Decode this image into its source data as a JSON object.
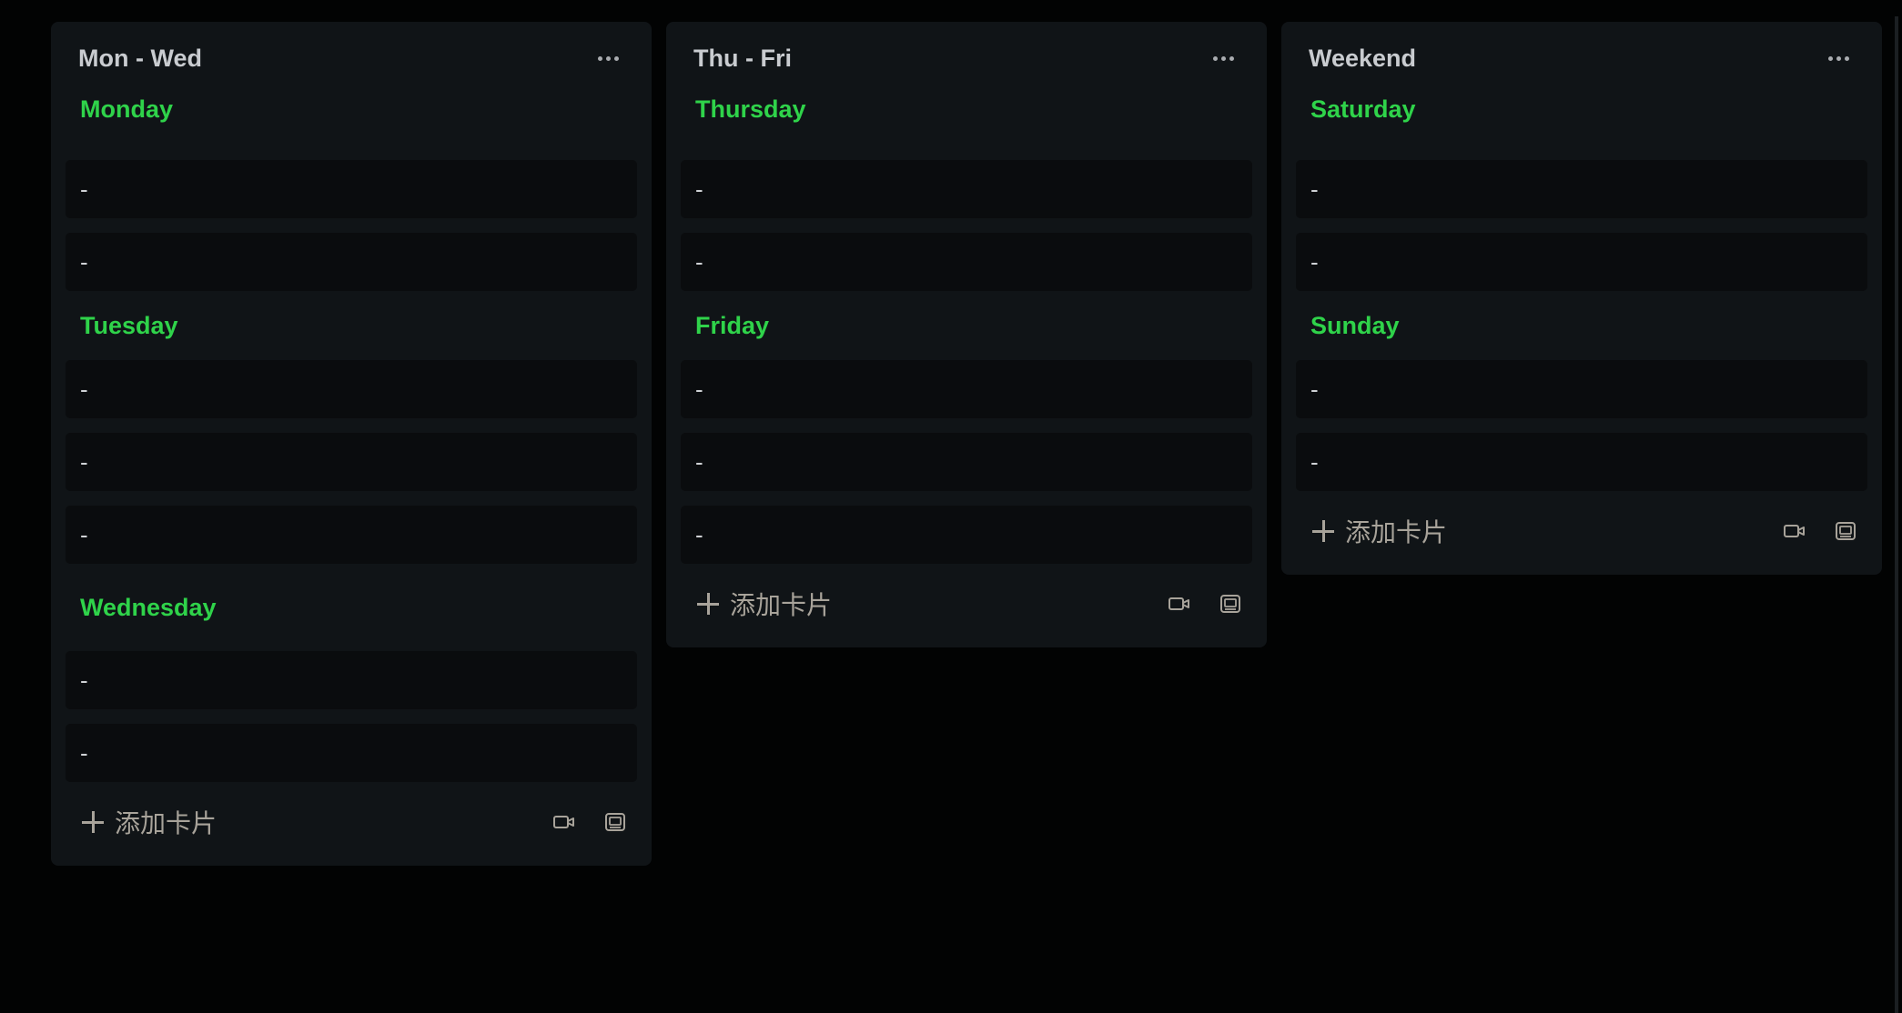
{
  "lists": [
    {
      "title": "Mon - Wed",
      "sections": [
        {
          "heading": "Monday",
          "cards": [
            "-",
            "-"
          ]
        },
        {
          "heading": "Tuesday",
          "cards": [
            "-",
            "-",
            "-"
          ]
        },
        {
          "heading": "Wednesday",
          "cards": [
            "-",
            "-"
          ]
        }
      ],
      "add_label": "添加卡片"
    },
    {
      "title": "Thu - Fri",
      "sections": [
        {
          "heading": "Thursday",
          "cards": [
            "-",
            "-"
          ]
        },
        {
          "heading": "Friday",
          "cards": [
            "-",
            "-",
            "-"
          ]
        }
      ],
      "add_label": "添加卡片"
    },
    {
      "title": "Weekend",
      "sections": [
        {
          "heading": "Saturday",
          "cards": [
            "-",
            "-"
          ]
        },
        {
          "heading": "Sunday",
          "cards": [
            "-",
            "-"
          ]
        }
      ],
      "add_label": "添加卡片"
    }
  ],
  "icons": {
    "more": "more-horizontal-icon",
    "add": "plus-icon",
    "video": "video-camera-icon",
    "template": "card-template-icon"
  },
  "colors": {
    "background": "#020303",
    "list_bg": "#101417",
    "card_bg": "#0a0c0e",
    "heading_green": "#2fd34a",
    "title_text": "#c9ccd0",
    "muted": "#a8a39a"
  }
}
